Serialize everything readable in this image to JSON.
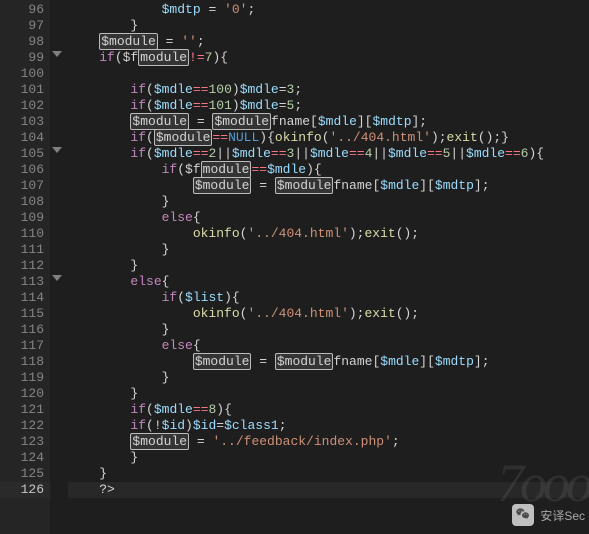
{
  "startLine": 96,
  "endLine": 126,
  "activeLine": 126,
  "foldLines": [
    99,
    105,
    113
  ],
  "code": {
    "l96": [
      [
        "v",
        "$mdtp"
      ],
      [
        "c",
        " = "
      ],
      [
        "s",
        "'0'"
      ],
      [
        "c",
        ";"
      ]
    ],
    "l97": [
      [
        "c",
        "}"
      ]
    ],
    "l98": [
      [
        "box",
        "$module"
      ],
      [
        "c",
        " = "
      ],
      [
        "s",
        "''"
      ],
      [
        "c",
        ";"
      ]
    ],
    "l99": [
      [
        "k",
        "if"
      ],
      [
        "c",
        "($f"
      ],
      [
        "box",
        "module"
      ],
      [
        "op",
        "!="
      ],
      [
        "n",
        "7"
      ],
      [
        "c",
        "){"
      ]
    ],
    "l100": [],
    "l101": [
      [
        "k",
        "if"
      ],
      [
        "c",
        "("
      ],
      [
        "v",
        "$mdle"
      ],
      [
        "op",
        "=="
      ],
      [
        "n",
        "100"
      ],
      [
        "c",
        ")"
      ],
      [
        "v",
        "$mdle"
      ],
      [
        "c",
        "="
      ],
      [
        "n",
        "3"
      ],
      [
        "c",
        ";"
      ]
    ],
    "l102": [
      [
        "k",
        "if"
      ],
      [
        "c",
        "("
      ],
      [
        "v",
        "$mdle"
      ],
      [
        "op",
        "=="
      ],
      [
        "n",
        "101"
      ],
      [
        "c",
        ")"
      ],
      [
        "v",
        "$mdle"
      ],
      [
        "c",
        "="
      ],
      [
        "n",
        "5"
      ],
      [
        "c",
        ";"
      ]
    ],
    "l103": [
      [
        "box",
        "$module"
      ],
      [
        "c",
        " = "
      ],
      [
        "box",
        "$module"
      ],
      [
        "c",
        "fname["
      ],
      [
        "v",
        "$mdle"
      ],
      [
        "c",
        "]["
      ],
      [
        "v",
        "$mdtp"
      ],
      [
        "c",
        "];"
      ]
    ],
    "l104": [
      [
        "k",
        "if"
      ],
      [
        "c",
        "("
      ],
      [
        "box",
        "$module"
      ],
      [
        "op",
        "=="
      ],
      [
        "nl",
        "NULL"
      ],
      [
        "c",
        "){"
      ],
      [
        "f",
        "okinfo"
      ],
      [
        "c",
        "("
      ],
      [
        "s",
        "'../404.html'"
      ],
      [
        "c",
        ");"
      ],
      [
        "f",
        "exit"
      ],
      [
        "c",
        "();}"
      ]
    ],
    "l105": [
      [
        "k",
        "if"
      ],
      [
        "c",
        "("
      ],
      [
        "v",
        "$mdle"
      ],
      [
        "op",
        "=="
      ],
      [
        "n",
        "2"
      ],
      [
        "c",
        "||"
      ],
      [
        "v",
        "$mdle"
      ],
      [
        "op",
        "=="
      ],
      [
        "n",
        "3"
      ],
      [
        "c",
        "||"
      ],
      [
        "v",
        "$mdle"
      ],
      [
        "op",
        "=="
      ],
      [
        "n",
        "4"
      ],
      [
        "c",
        "||"
      ],
      [
        "v",
        "$mdle"
      ],
      [
        "op",
        "=="
      ],
      [
        "n",
        "5"
      ],
      [
        "c",
        "||"
      ],
      [
        "v",
        "$mdle"
      ],
      [
        "op",
        "=="
      ],
      [
        "n",
        "6"
      ],
      [
        "c",
        "){"
      ]
    ],
    "l106": [
      [
        "k",
        "if"
      ],
      [
        "c",
        "($f"
      ],
      [
        "box",
        "module"
      ],
      [
        "op",
        "=="
      ],
      [
        "v",
        "$mdle"
      ],
      [
        "c",
        "){"
      ]
    ],
    "l107": [
      [
        "box",
        "$module"
      ],
      [
        "c",
        " = "
      ],
      [
        "box",
        "$module"
      ],
      [
        "c",
        "fname["
      ],
      [
        "v",
        "$mdle"
      ],
      [
        "c",
        "]["
      ],
      [
        "v",
        "$mdtp"
      ],
      [
        "c",
        "];"
      ]
    ],
    "l108": [
      [
        "c",
        "}"
      ]
    ],
    "l109": [
      [
        "k",
        "else"
      ],
      [
        "c",
        "{"
      ]
    ],
    "l110": [
      [
        "f",
        "okinfo"
      ],
      [
        "c",
        "("
      ],
      [
        "s",
        "'../404.html'"
      ],
      [
        "c",
        ");"
      ],
      [
        "f",
        "exit"
      ],
      [
        "c",
        "();"
      ]
    ],
    "l111": [
      [
        "c",
        "}"
      ]
    ],
    "l112": [
      [
        "c",
        "}"
      ]
    ],
    "l113": [
      [
        "k",
        "else"
      ],
      [
        "c",
        "{"
      ]
    ],
    "l114": [
      [
        "k",
        "if"
      ],
      [
        "c",
        "("
      ],
      [
        "v",
        "$list"
      ],
      [
        "c",
        "){"
      ]
    ],
    "l115": [
      [
        "f",
        "okinfo"
      ],
      [
        "c",
        "("
      ],
      [
        "s",
        "'../404.html'"
      ],
      [
        "c",
        ");"
      ],
      [
        "f",
        "exit"
      ],
      [
        "c",
        "();"
      ]
    ],
    "l116": [
      [
        "c",
        "}"
      ]
    ],
    "l117": [
      [
        "k",
        "else"
      ],
      [
        "c",
        "{"
      ]
    ],
    "l118": [
      [
        "box",
        "$module"
      ],
      [
        "c",
        " = "
      ],
      [
        "box",
        "$module"
      ],
      [
        "c",
        "fname["
      ],
      [
        "v",
        "$mdle"
      ],
      [
        "c",
        "]["
      ],
      [
        "v",
        "$mdtp"
      ],
      [
        "c",
        "];"
      ]
    ],
    "l119": [
      [
        "c",
        "}"
      ]
    ],
    "l120": [
      [
        "c",
        "}"
      ]
    ],
    "l121": [
      [
        "k",
        "if"
      ],
      [
        "c",
        "("
      ],
      [
        "v",
        "$mdle"
      ],
      [
        "op",
        "=="
      ],
      [
        "n",
        "8"
      ],
      [
        "c",
        "){"
      ]
    ],
    "l122": [
      [
        "k",
        "if"
      ],
      [
        "c",
        "(!"
      ],
      [
        "v",
        "$id"
      ],
      [
        "c",
        ")"
      ],
      [
        "v",
        "$id"
      ],
      [
        "c",
        "="
      ],
      [
        "v",
        "$class1"
      ],
      [
        "c",
        ";"
      ]
    ],
    "l123": [
      [
        "box",
        "$module"
      ],
      [
        "c",
        " = "
      ],
      [
        "s",
        "'../feedback/index.php'"
      ],
      [
        "c",
        ";"
      ]
    ],
    "l124": [
      [
        "c",
        "}"
      ]
    ],
    "l125": [
      [
        "c",
        "}"
      ]
    ],
    "l126": [
      [
        "c",
        "?>"
      ]
    ]
  },
  "indent": {
    "l96": 3,
    "l97": 2,
    "l98": 1,
    "l99": 1,
    "l100": 0,
    "l101": 2,
    "l102": 2,
    "l103": 2,
    "l104": 2,
    "l105": 2,
    "l106": 3,
    "l107": 4,
    "l108": 3,
    "l109": 3,
    "l110": 4,
    "l111": 3,
    "l112": 2,
    "l113": 2,
    "l114": 3,
    "l115": 4,
    "l116": 3,
    "l117": 3,
    "l118": 4,
    "l119": 3,
    "l120": 2,
    "l121": 2,
    "l122": 2,
    "l123": 2,
    "l124": 2,
    "l125": 1,
    "l126": 1
  },
  "watermark": {
    "text": "安译Sec",
    "bgText": "7ooo"
  }
}
